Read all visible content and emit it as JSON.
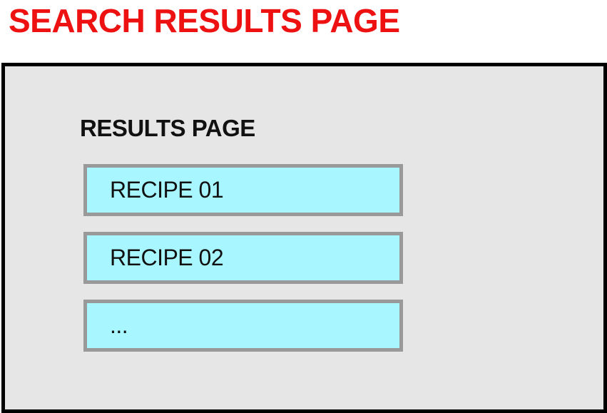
{
  "heading": "SEARCH RESULTS PAGE",
  "results_page": {
    "title": "RESULTS PAGE",
    "items": [
      {
        "label": "RECIPE 01"
      },
      {
        "label": "RECIPE 02"
      },
      {
        "label": "..."
      }
    ]
  },
  "colors": {
    "heading": "#ee1111",
    "frame_background": "#e6e6e6",
    "frame_border": "#000000",
    "item_background": "#a8f6ff",
    "item_border": "#999999"
  }
}
